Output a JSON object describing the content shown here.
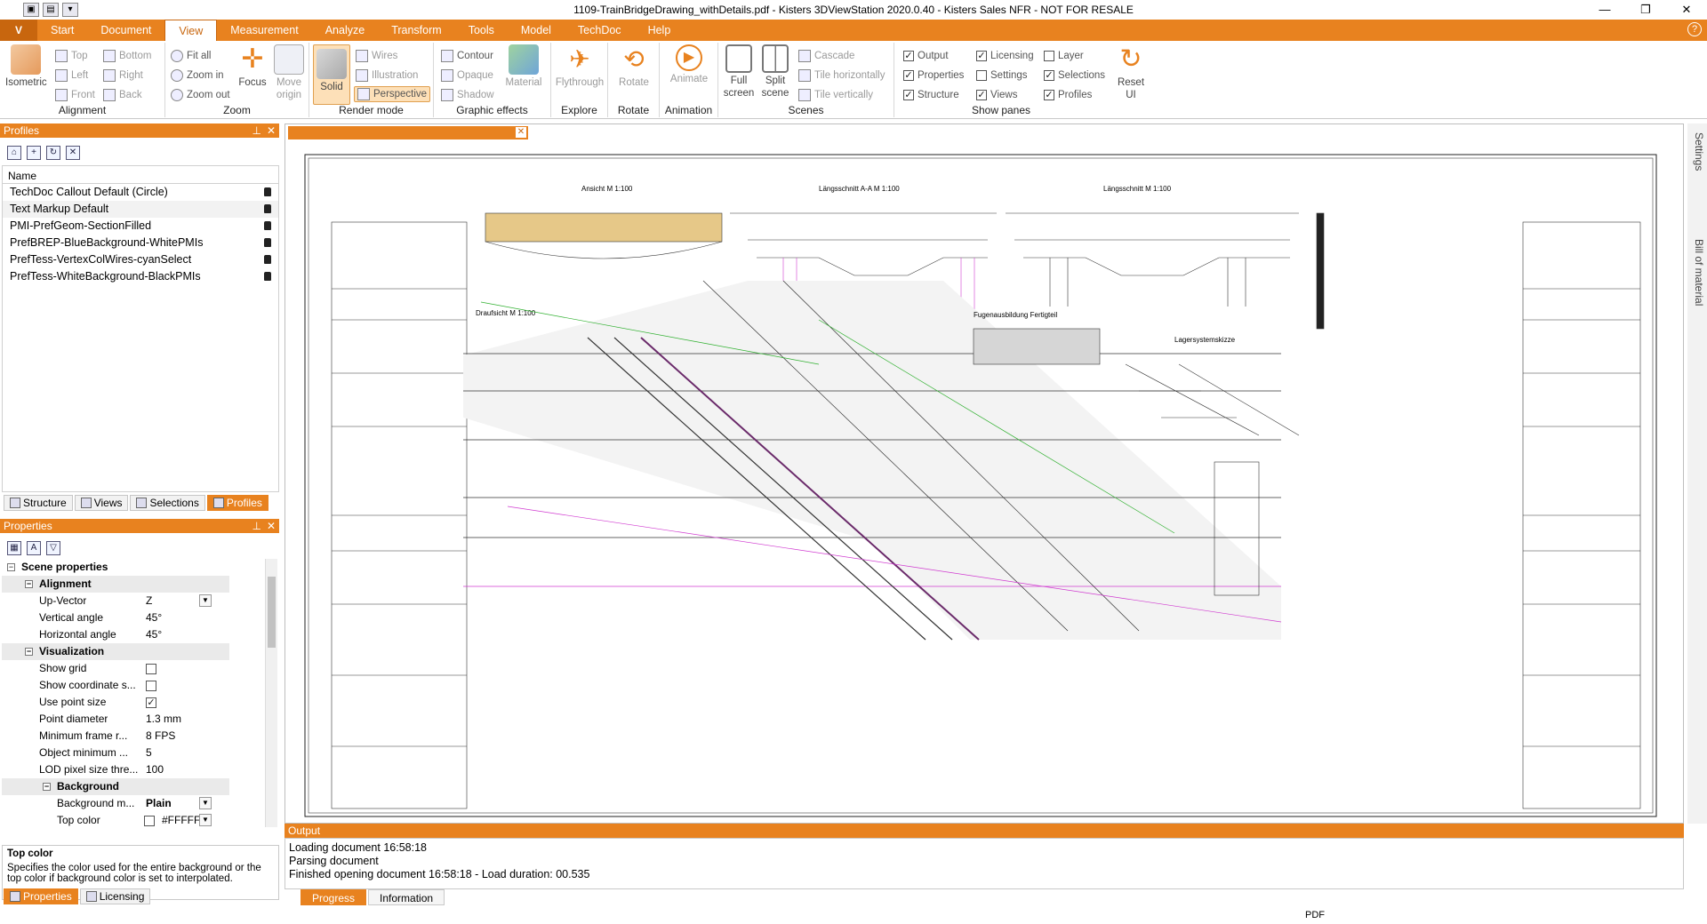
{
  "window": {
    "title": "1109-TrainBridgeDrawing_withDetails.pdf - Kisters 3DViewStation 2020.0.40 - Kisters Sales NFR - NOT FOR RESALE"
  },
  "menu": {
    "app_button": "V",
    "tabs": [
      "Start",
      "Document",
      "View",
      "Measurement",
      "Analyze",
      "Transform",
      "Tools",
      "Model",
      "TechDoc",
      "Help"
    ],
    "active": "View"
  },
  "ribbon": {
    "alignment": {
      "label": "Alignment",
      "isometric": "Isometric",
      "top": "Top",
      "bottom": "Bottom",
      "left": "Left",
      "right": "Right",
      "front": "Front",
      "back": "Back"
    },
    "zoom": {
      "label": "Zoom",
      "fit_all": "Fit all",
      "zoom_in": "Zoom in",
      "zoom_out": "Zoom out",
      "focus": "Focus",
      "move_origin": "Move origin"
    },
    "render_mode": {
      "label": "Render mode",
      "solid": "Solid",
      "wires": "Wires",
      "illustration": "Illustration",
      "perspective": "Perspective"
    },
    "graphic_effects": {
      "label": "Graphic effects",
      "contour": "Contour",
      "opaque": "Opaque",
      "shadow": "Shadow",
      "material": "Material"
    },
    "explore": {
      "label": "Explore",
      "flythrough": "Flythrough"
    },
    "rotate": {
      "label": "Rotate",
      "rotate": "Rotate"
    },
    "animation": {
      "label": "Animation",
      "animate": "Animate"
    },
    "scenes": {
      "label": "Scenes",
      "full_screen": "Full screen",
      "split_scene": "Split scene",
      "cascade": "Cascade",
      "tile_h": "Tile horizontally",
      "tile_v": "Tile vertically"
    },
    "show_panes": {
      "label": "Show panes",
      "output": "Output",
      "properties": "Properties",
      "structure": "Structure",
      "licensing": "Licensing",
      "settings": "Settings",
      "views": "Views",
      "layer": "Layer",
      "selections": "Selections",
      "profiles": "Profiles",
      "reset_ui": "Reset UI"
    }
  },
  "profiles": {
    "title": "Profiles",
    "column": "Name",
    "items": [
      "TechDoc Callout Default (Circle)",
      "Text Markup Default",
      "PMI-PrefGeom-SectionFilled",
      "PrefBREP-BlueBackground-WhitePMIs",
      "PrefTess-VertexColWires-cyanSelect",
      "PrefTess-WhiteBackground-BlackPMIs"
    ],
    "tabs": [
      "Structure",
      "Views",
      "Selections",
      "Profiles"
    ]
  },
  "properties": {
    "title": "Properties",
    "scene": "Scene properties",
    "alignment": "Alignment",
    "up_vector": {
      "k": "Up-Vector",
      "v": "Z"
    },
    "vertical_angle": {
      "k": "Vertical angle",
      "v": "45°"
    },
    "horizontal_angle": {
      "k": "Horizontal angle",
      "v": "45°"
    },
    "visualization": "Visualization",
    "show_grid": {
      "k": "Show grid"
    },
    "show_coord": {
      "k": "Show coordinate s..."
    },
    "use_point_size": {
      "k": "Use point size"
    },
    "point_diameter": {
      "k": "Point diameter",
      "v": "1.3 mm"
    },
    "min_frame": {
      "k": "Minimum frame r...",
      "v": "8 FPS"
    },
    "obj_min": {
      "k": "Object minimum ...",
      "v": "5"
    },
    "lod": {
      "k": "LOD pixel size thre...",
      "v": "100"
    },
    "background": "Background",
    "bg_mode": {
      "k": "Background m...",
      "v": "Plain"
    },
    "top_color": {
      "k": "Top color",
      "v": "#FFFFFF"
    },
    "help_title": "Top color",
    "help_text": "Specifies the color used for the entire background or the top color if background color is set to interpolated.",
    "tabs": [
      "Properties",
      "Licensing"
    ]
  },
  "side_tabs": [
    "Settings",
    "Bill of material"
  ],
  "output": {
    "title": "Output",
    "lines": [
      "Loading document 16:58:18",
      "Parsing document",
      "Finished opening document 16:58:18 - Load duration: 00.535"
    ],
    "tabs": [
      "Progress",
      "Information"
    ]
  },
  "drawing": {
    "views": [
      "Ansicht  M 1:100",
      "Längsschnitt A-A  M 1:100",
      "Längsschnitt  M 1:100",
      "Draufsicht  M 1:100",
      "Fugenausbildung Fertigteil",
      "Lagersystemskizze"
    ]
  },
  "status": {
    "right": "PDF"
  },
  "colors": {
    "accent": "#e8821f",
    "accent_dark": "#c8660e"
  }
}
